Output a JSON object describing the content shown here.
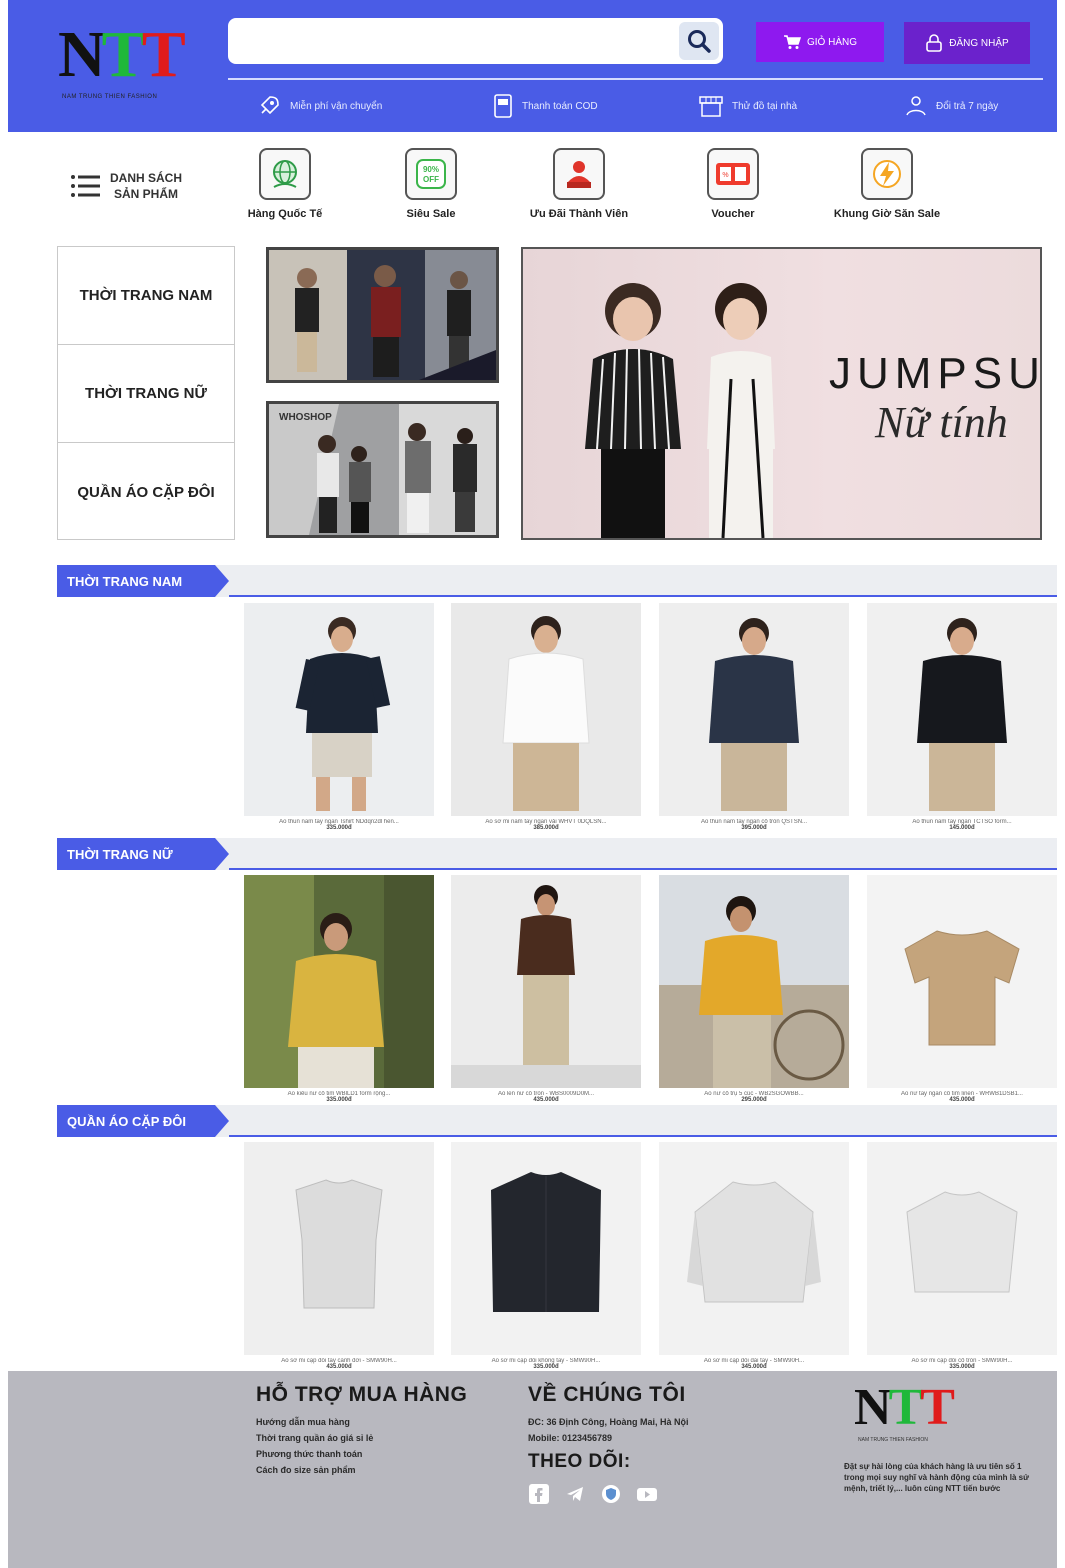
{
  "header": {
    "logo": {
      "mark": "NTT",
      "tagline": "NAM TRUNG THIEN FASHION"
    },
    "search": {
      "placeholder": ""
    },
    "cart_label": "GIỎ HÀNG",
    "login_label": "ĐĂNG NHẬP",
    "benefits": [
      {
        "icon": "rocket-icon",
        "label": "Miễn phí vận chuyển"
      },
      {
        "icon": "payment-icon",
        "label": "Thanh toán COD"
      },
      {
        "icon": "store-icon",
        "label": "Thử đồ tại nhà"
      },
      {
        "icon": "return-icon",
        "label": "Đổi trả 7 ngày"
      }
    ]
  },
  "catmenu": {
    "label_line1": "DANH SÁCH",
    "label_line2": "SẢN PHẨM"
  },
  "quick_links": [
    {
      "icon": "globe-icon",
      "label": "Hàng Quốc Tế",
      "color": "#2e9b48"
    },
    {
      "icon": "sale-tag-icon",
      "label": "Siêu Sale",
      "color": "#3bb54a"
    },
    {
      "icon": "member-icon",
      "label": "Ưu Đãi Thành Viên",
      "color": "#e0352b"
    },
    {
      "icon": "voucher-icon",
      "label": "Voucher",
      "color": "#ef3b2d"
    },
    {
      "icon": "lightning-icon",
      "label": "Khung Giờ Săn Sale",
      "color": "#f5a623"
    }
  ],
  "sidebar": {
    "items": [
      {
        "label": "THỜI TRANG NAM"
      },
      {
        "label": "THỜI TRANG NỮ"
      },
      {
        "label": "QUẦN ÁO CẶP ĐÔI"
      }
    ]
  },
  "banner": {
    "title": "JUMPSUIT",
    "subtitle": "Nữ tính"
  },
  "sections": [
    {
      "title": "THỜI TRANG NAM",
      "products": [
        {
          "name": "Áo thun nam tay ngắn Tshirt NDdqn2dl hen...",
          "price": "335.000đ"
        },
        {
          "name": "Áo sơ mi nam tay ngắn vải WHVT 0DQLSN...",
          "price": "385.000đ"
        },
        {
          "name": "Áo thun nam tay ngắn cổ tròn QSTSN...",
          "price": "395.000đ"
        },
        {
          "name": "Áo thun nam tay ngắn TCTSO form...",
          "price": "145.000đ"
        }
      ]
    },
    {
      "title": "THỜI TRANG NỮ",
      "products": [
        {
          "name": "Áo kiểu nữ cổ tim WBlLD1 form rộng...",
          "price": "335.000đ"
        },
        {
          "name": "Áo len nữ cổ tròn - WBS0009D0M...",
          "price": "435.000đ"
        },
        {
          "name": "Áo nữ cổ trụ 5 cúc - WB2SGOWBB...",
          "price": "295.000đ"
        },
        {
          "name": "Áo nữ tay ngắn cổ tim linen - WRWB1DSB1...",
          "price": "435.000đ"
        }
      ]
    },
    {
      "title": "QUẦN ÁO CẶP ĐÔI",
      "products": [
        {
          "name": "Áo sơ mi cặp đôi tay cánh dơi - SMW90H...",
          "price": "435.000đ"
        },
        {
          "name": "Áo sơ mi cặp đôi không tay - SMW90H...",
          "price": "335.000đ"
        },
        {
          "name": "Áo sơ mi cặp đôi dài tay - SMW90H...",
          "price": "345.000đ"
        },
        {
          "name": "Áo sơ mi cặp đôi cổ tròn - SMW90H...",
          "price": "335.000đ"
        }
      ]
    }
  ],
  "footer": {
    "support": {
      "title": "HỖ TRỢ MUA HÀNG",
      "links": [
        "Hướng dẫn mua hàng",
        "Thời trang quần áo giá sỉ lẻ",
        "Phương thức thanh toán",
        "Cách đo size sản phẩm"
      ]
    },
    "about": {
      "title": "VỀ CHÚNG TÔI",
      "address": "ĐC: 36 Định Công, Hoàng Mai, Hà Nội",
      "mobile": "Mobile: 0123456789",
      "follow_title": "THEO DÕI:",
      "social": [
        "facebook-icon",
        "telegram-icon",
        "shield-icon",
        "youtube-icon"
      ]
    },
    "brand": {
      "mark": "NTT",
      "tagline": "NAM TRUNG THIEN FASHION",
      "description": "Đặt sự hài lòng của khách hàng là ưu tiên số 1 trong mọi suy nghĩ và hành động của mình là sứ mệnh, triết lý,... luôn cùng NTT tiến bước"
    }
  },
  "colors": {
    "brand": "#4a5ce6",
    "cart": "#8e19ef",
    "login": "#6b22cc",
    "footer": "#b8b8bf"
  }
}
